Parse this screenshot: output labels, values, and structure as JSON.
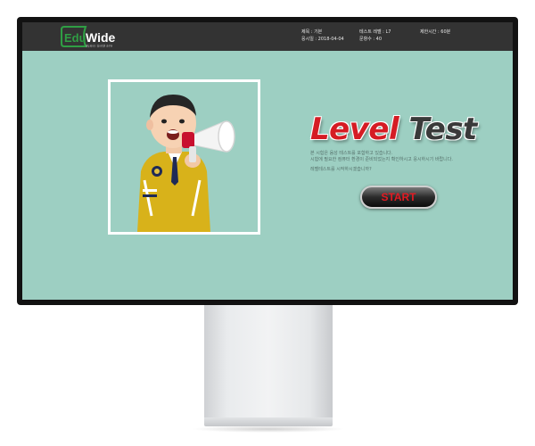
{
  "app": {
    "logo_text_edu": "Edu",
    "logo_text_wide": "Wide",
    "logo_tagline": "에듀와이드 영어학원 솔루션"
  },
  "header": {
    "subject_label": "제목 : 기본",
    "date_label": "응시일 : 2018-04-04",
    "level_label": "테스트 레벨 : L7",
    "count_label": "문항수 : 40",
    "time_label": "제한시간 : 60분"
  },
  "main": {
    "title_word1": "Level",
    "title_word2": "Test",
    "desc_line1": "본 시험은 음성 테스트를 포함하고 있습니다.",
    "desc_line2": "시험에 필요한 컴퓨터 환경이 준비되었는지 확인하시고 응시하시기 바랍니다.",
    "desc_line3": "레벨테스트를 시작하시겠습니까?",
    "start_label": "START"
  },
  "colors": {
    "screen_bg": "#9dcfc2",
    "topbar_bg": "#333333",
    "accent_red": "#d51c24",
    "logo_green": "#2f9e44"
  }
}
